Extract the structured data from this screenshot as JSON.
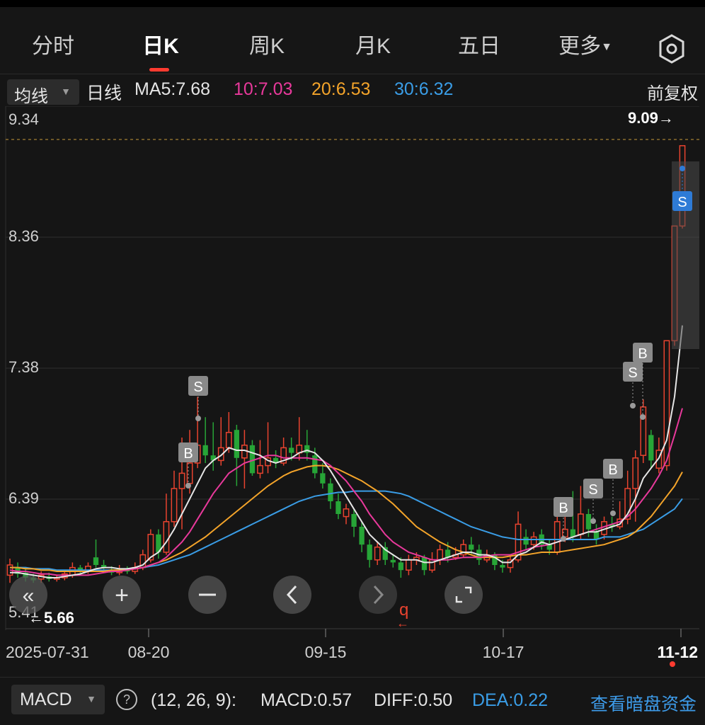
{
  "tabs": [
    {
      "label": "分时",
      "active": false
    },
    {
      "label": "日K",
      "active": true
    },
    {
      "label": "周K",
      "active": false
    },
    {
      "label": "月K",
      "active": false
    },
    {
      "label": "五日",
      "active": false
    },
    {
      "label": "更多",
      "active": false
    }
  ],
  "ma_bar": {
    "select_label": "均线",
    "period_label": "日线",
    "ma5": "MA5:7.68",
    "ma10": "10:7.03",
    "ma20": "20:6.53",
    "ma30": "30:6.32",
    "adjust_label": "前复权"
  },
  "colors": {
    "up": "#e8432f",
    "down": "#27a537",
    "ma5": "#e6e6e6",
    "ma10": "#e8399b",
    "ma20": "#f4a42a",
    "ma30": "#3a9de6",
    "accent": "#ff3b30",
    "link": "#3d9be9"
  },
  "price_axis": {
    "labels": [
      "9.34",
      "8.36",
      "7.38",
      "6.39",
      "5.41"
    ],
    "high_marker": "9.09→",
    "low_marker": "←5.66"
  },
  "date_axis": {
    "labels": [
      "2025-07-31",
      "08-20",
      "09-15",
      "10-17",
      "11-12"
    ]
  },
  "trade_markers": [
    "S",
    "B",
    "B",
    "S",
    "B",
    "S",
    "B",
    "S",
    "B",
    "S"
  ],
  "nav_controls": [
    "fast-back",
    "zoom-in",
    "zoom-out",
    "prev",
    "next",
    "reset"
  ],
  "macd": {
    "select_label": "MACD",
    "params": "(12, 26, 9):",
    "macd_value": "MACD:0.57",
    "diff_value": "DIFF:0.50",
    "dea_value": "DEA:0.22",
    "dark_pool_link": "查看暗盘资金"
  },
  "chart_data": {
    "type": "candlestick",
    "ylim": [
      5.3,
      9.4
    ],
    "x_labels": [
      "2025-07-31",
      "08-20",
      "09-15",
      "10-17",
      "11-12"
    ],
    "candles": [
      {
        "o": 5.72,
        "c": 5.8,
        "h": 5.85,
        "l": 5.66
      },
      {
        "o": 5.78,
        "c": 5.73,
        "h": 5.82,
        "l": 5.7
      },
      {
        "o": 5.74,
        "c": 5.7,
        "h": 5.78,
        "l": 5.67
      },
      {
        "o": 5.7,
        "c": 5.68,
        "h": 5.73,
        "l": 5.66
      },
      {
        "o": 5.69,
        "c": 5.72,
        "h": 5.75,
        "l": 5.66
      },
      {
        "o": 5.71,
        "c": 5.69,
        "h": 5.74,
        "l": 5.67
      },
      {
        "o": 5.69,
        "c": 5.7,
        "h": 5.72,
        "l": 5.67
      },
      {
        "o": 5.7,
        "c": 5.73,
        "h": 5.76,
        "l": 5.68
      },
      {
        "o": 5.72,
        "c": 5.78,
        "h": 5.82,
        "l": 5.7
      },
      {
        "o": 5.78,
        "c": 5.75,
        "h": 5.8,
        "l": 5.72
      },
      {
        "o": 5.75,
        "c": 5.79,
        "h": 5.82,
        "l": 5.73
      },
      {
        "o": 5.86,
        "c": 5.8,
        "h": 6.0,
        "l": 5.78
      },
      {
        "o": 5.8,
        "c": 5.78,
        "h": 5.84,
        "l": 5.75
      },
      {
        "o": 5.76,
        "c": 5.74,
        "h": 5.79,
        "l": 5.72
      },
      {
        "o": 5.74,
        "c": 5.76,
        "h": 5.8,
        "l": 5.72
      },
      {
        "o": 5.76,
        "c": 5.75,
        "h": 5.79,
        "l": 5.73
      },
      {
        "o": 5.75,
        "c": 5.78,
        "h": 5.82,
        "l": 5.73
      },
      {
        "o": 5.78,
        "c": 5.88,
        "h": 5.92,
        "l": 5.76
      },
      {
        "o": 5.84,
        "c": 6.04,
        "h": 6.08,
        "l": 5.82
      },
      {
        "o": 6.04,
        "c": 5.9,
        "h": 6.08,
        "l": 5.85
      },
      {
        "o": 5.9,
        "c": 6.14,
        "h": 6.36,
        "l": 5.88
      },
      {
        "o": 6.14,
        "c": 6.4,
        "h": 6.54,
        "l": 6.1
      },
      {
        "o": 6.4,
        "c": 6.52,
        "h": 6.8,
        "l": 6.08
      },
      {
        "o": 6.44,
        "c": 6.6,
        "h": 6.86,
        "l": 6.36
      },
      {
        "o": 6.6,
        "c": 6.74,
        "h": 7.12,
        "l": 6.56
      },
      {
        "o": 6.74,
        "c": 6.66,
        "h": 6.96,
        "l": 6.6
      },
      {
        "o": 6.66,
        "c": 6.62,
        "h": 6.92,
        "l": 6.54
      },
      {
        "o": 6.62,
        "c": 6.72,
        "h": 6.96,
        "l": 6.58
      },
      {
        "o": 6.72,
        "c": 6.84,
        "h": 7.0,
        "l": 6.68
      },
      {
        "o": 6.86,
        "c": 6.64,
        "h": 6.9,
        "l": 6.42
      },
      {
        "o": 6.64,
        "c": 6.74,
        "h": 6.86,
        "l": 6.4
      },
      {
        "o": 6.74,
        "c": 6.52,
        "h": 6.78,
        "l": 6.5
      },
      {
        "o": 6.52,
        "c": 6.58,
        "h": 6.78,
        "l": 6.48
      },
      {
        "o": 6.58,
        "c": 6.64,
        "h": 6.92,
        "l": 6.52
      },
      {
        "o": 6.64,
        "c": 6.6,
        "h": 6.7,
        "l": 6.56
      },
      {
        "o": 6.6,
        "c": 6.72,
        "h": 6.8,
        "l": 6.58
      },
      {
        "o": 6.72,
        "c": 6.68,
        "h": 6.8,
        "l": 6.62
      },
      {
        "o": 6.68,
        "c": 6.74,
        "h": 6.96,
        "l": 6.62
      },
      {
        "o": 6.74,
        "c": 6.68,
        "h": 6.86,
        "l": 6.62
      },
      {
        "o": 6.66,
        "c": 6.52,
        "h": 6.72,
        "l": 6.48
      },
      {
        "o": 6.52,
        "c": 6.44,
        "h": 6.6,
        "l": 6.4
      },
      {
        "o": 6.44,
        "c": 6.3,
        "h": 6.48,
        "l": 6.24
      },
      {
        "o": 6.3,
        "c": 6.2,
        "h": 6.36,
        "l": 6.16
      },
      {
        "o": 6.18,
        "c": 6.24,
        "h": 6.28,
        "l": 6.12
      },
      {
        "o": 6.2,
        "c": 6.1,
        "h": 6.24,
        "l": 6.02
      },
      {
        "o": 6.1,
        "c": 5.96,
        "h": 6.14,
        "l": 5.9
      },
      {
        "o": 5.96,
        "c": 5.84,
        "h": 6.0,
        "l": 5.78
      },
      {
        "o": 5.84,
        "c": 5.94,
        "h": 5.98,
        "l": 5.8
      },
      {
        "o": 5.94,
        "c": 5.84,
        "h": 5.98,
        "l": 5.8
      },
      {
        "o": 5.84,
        "c": 5.82,
        "h": 5.88,
        "l": 5.78
      },
      {
        "o": 5.82,
        "c": 5.76,
        "h": 5.86,
        "l": 5.7
      },
      {
        "o": 5.76,
        "c": 5.84,
        "h": 5.88,
        "l": 5.72
      },
      {
        "o": 5.84,
        "c": 5.86,
        "h": 5.9,
        "l": 5.8
      },
      {
        "o": 5.86,
        "c": 5.76,
        "h": 5.88,
        "l": 5.72
      },
      {
        "o": 5.76,
        "c": 5.84,
        "h": 5.9,
        "l": 5.74
      },
      {
        "o": 5.84,
        "c": 5.92,
        "h": 5.96,
        "l": 5.8
      },
      {
        "o": 5.92,
        "c": 5.86,
        "h": 5.98,
        "l": 5.82
      },
      {
        "o": 5.86,
        "c": 5.88,
        "h": 5.94,
        "l": 5.84
      },
      {
        "o": 5.88,
        "c": 5.96,
        "h": 6.0,
        "l": 5.86
      },
      {
        "o": 5.96,
        "c": 5.92,
        "h": 6.02,
        "l": 5.88
      },
      {
        "o": 5.92,
        "c": 5.84,
        "h": 5.96,
        "l": 5.8
      },
      {
        "o": 5.84,
        "c": 5.88,
        "h": 5.92,
        "l": 5.82
      },
      {
        "o": 5.88,
        "c": 5.8,
        "h": 5.9,
        "l": 5.76
      },
      {
        "o": 5.8,
        "c": 5.78,
        "h": 5.84,
        "l": 5.74
      },
      {
        "o": 5.78,
        "c": 5.84,
        "h": 5.88,
        "l": 5.74
      },
      {
        "o": 5.84,
        "c": 6.12,
        "h": 6.22,
        "l": 5.82
      },
      {
        "o": 6.02,
        "c": 5.96,
        "h": 6.08,
        "l": 5.92
      },
      {
        "o": 5.96,
        "c": 6.02,
        "h": 6.06,
        "l": 5.92
      },
      {
        "o": 6.04,
        "c": 5.96,
        "h": 6.08,
        "l": 5.92
      },
      {
        "o": 5.96,
        "c": 5.92,
        "h": 6.0,
        "l": 5.88
      },
      {
        "o": 5.9,
        "c": 6.14,
        "h": 6.22,
        "l": 5.88
      },
      {
        "o": 6.02,
        "c": 6.08,
        "h": 6.24,
        "l": 5.98
      },
      {
        "o": 6.08,
        "c": 6.02,
        "h": 6.38,
        "l": 5.98
      },
      {
        "o": 6.04,
        "c": 6.2,
        "h": 6.42,
        "l": 6.0
      },
      {
        "o": 6.2,
        "c": 6.08,
        "h": 6.24,
        "l": 6.02
      },
      {
        "o": 6.06,
        "c": 6.0,
        "h": 6.12,
        "l": 5.96
      },
      {
        "o": 6.04,
        "c": 6.14,
        "h": 6.18,
        "l": 6.0
      },
      {
        "o": 6.12,
        "c": 6.1,
        "h": 6.18,
        "l": 6.06
      },
      {
        "o": 6.1,
        "c": 6.16,
        "h": 6.3,
        "l": 6.08
      },
      {
        "o": 6.16,
        "c": 6.4,
        "h": 6.54,
        "l": 6.12
      },
      {
        "o": 6.4,
        "c": 6.64,
        "h": 6.7,
        "l": 6.14
      },
      {
        "o": 6.66,
        "c": 7.04,
        "h": 7.1,
        "l": 6.6
      },
      {
        "o": 6.82,
        "c": 6.62,
        "h": 6.86,
        "l": 6.56
      },
      {
        "o": 6.56,
        "c": 6.7,
        "h": 6.8,
        "l": 6.52
      },
      {
        "o": 6.58,
        "c": 7.56,
        "h": 7.56,
        "l": 6.54
      },
      {
        "o": 7.56,
        "c": 8.46,
        "h": 8.46,
        "l": 7.52
      },
      {
        "o": 8.46,
        "c": 9.09,
        "h": 9.09,
        "l": 8.44
      }
    ],
    "ma5": [
      5.74,
      5.74,
      5.73,
      5.72,
      5.71,
      5.7,
      5.7,
      5.71,
      5.72,
      5.73,
      5.75,
      5.77,
      5.78,
      5.78,
      5.77,
      5.77,
      5.78,
      5.8,
      5.86,
      5.9,
      5.98,
      6.08,
      6.2,
      6.32,
      6.44,
      6.56,
      6.62,
      6.66,
      6.72,
      6.7,
      6.7,
      6.68,
      6.66,
      6.62,
      6.6,
      6.62,
      6.64,
      6.68,
      6.7,
      6.68,
      6.62,
      6.54,
      6.44,
      6.34,
      6.24,
      6.14,
      6.04,
      5.98,
      5.92,
      5.88,
      5.84,
      5.84,
      5.84,
      5.82,
      5.82,
      5.84,
      5.86,
      5.88,
      5.9,
      5.9,
      5.88,
      5.88,
      5.86,
      5.82,
      5.82,
      5.88,
      5.9,
      5.94,
      5.98,
      5.96,
      5.98,
      6.0,
      6.02,
      6.04,
      6.06,
      6.06,
      6.08,
      6.1,
      6.12,
      6.2,
      6.32,
      6.48,
      6.56,
      6.64,
      6.78,
      7.12,
      7.68
    ],
    "ma10": [
      5.76,
      5.75,
      5.75,
      5.74,
      5.73,
      5.73,
      5.72,
      5.72,
      5.72,
      5.72,
      5.72,
      5.73,
      5.74,
      5.75,
      5.75,
      5.76,
      5.77,
      5.78,
      5.8,
      5.82,
      5.86,
      5.92,
      5.98,
      6.06,
      6.16,
      6.26,
      6.36,
      6.44,
      6.52,
      6.56,
      6.6,
      6.62,
      6.64,
      6.66,
      6.66,
      6.64,
      6.64,
      6.64,
      6.64,
      6.63,
      6.62,
      6.58,
      6.52,
      6.46,
      6.38,
      6.3,
      6.2,
      6.12,
      6.04,
      5.98,
      5.94,
      5.9,
      5.88,
      5.86,
      5.84,
      5.84,
      5.84,
      5.85,
      5.86,
      5.86,
      5.86,
      5.87,
      5.88,
      5.88,
      5.88,
      5.9,
      5.92,
      5.94,
      5.95,
      5.96,
      5.98,
      6.0,
      6.02,
      6.04,
      6.06,
      6.08,
      6.1,
      6.12,
      6.14,
      6.18,
      6.24,
      6.32,
      6.4,
      6.5,
      6.62,
      6.82,
      7.03
    ],
    "ma20": [
      5.78,
      5.78,
      5.77,
      5.77,
      5.76,
      5.76,
      5.75,
      5.75,
      5.75,
      5.75,
      5.75,
      5.75,
      5.75,
      5.76,
      5.76,
      5.76,
      5.77,
      5.78,
      5.8,
      5.82,
      5.84,
      5.87,
      5.9,
      5.94,
      5.98,
      6.02,
      6.07,
      6.12,
      6.17,
      6.22,
      6.27,
      6.32,
      6.37,
      6.42,
      6.46,
      6.5,
      6.53,
      6.55,
      6.57,
      6.58,
      6.58,
      6.57,
      6.55,
      6.52,
      6.49,
      6.46,
      6.42,
      6.38,
      6.33,
      6.28,
      6.22,
      6.16,
      6.1,
      6.06,
      6.02,
      5.98,
      5.95,
      5.92,
      5.9,
      5.88,
      5.86,
      5.86,
      5.86,
      5.86,
      5.87,
      5.88,
      5.88,
      5.89,
      5.9,
      5.9,
      5.9,
      5.91,
      5.92,
      5.93,
      5.94,
      5.95,
      5.96,
      5.98,
      6.0,
      6.02,
      6.06,
      6.12,
      6.18,
      6.26,
      6.34,
      6.42,
      6.53
    ],
    "ma30": [
      5.78,
      5.78,
      5.78,
      5.77,
      5.77,
      5.77,
      5.76,
      5.76,
      5.76,
      5.76,
      5.76,
      5.76,
      5.76,
      5.76,
      5.76,
      5.77,
      5.77,
      5.78,
      5.79,
      5.8,
      5.82,
      5.84,
      5.86,
      5.88,
      5.91,
      5.94,
      5.97,
      6.0,
      6.03,
      6.06,
      6.09,
      6.12,
      6.15,
      6.18,
      6.21,
      6.24,
      6.27,
      6.3,
      6.32,
      6.34,
      6.35,
      6.36,
      6.37,
      6.37,
      6.38,
      6.38,
      6.38,
      6.38,
      6.38,
      6.37,
      6.36,
      6.34,
      6.31,
      6.28,
      6.25,
      6.22,
      6.19,
      6.16,
      6.13,
      6.1,
      6.08,
      6.06,
      6.04,
      6.02,
      6.01,
      6.0,
      6.0,
      6.0,
      6.0,
      6.0,
      6.0,
      6.0,
      6.0,
      6.0,
      6.0,
      6.0,
      6.02,
      6.02,
      6.02,
      6.04,
      6.06,
      6.08,
      6.12,
      6.16,
      6.2,
      6.24,
      6.32
    ]
  }
}
